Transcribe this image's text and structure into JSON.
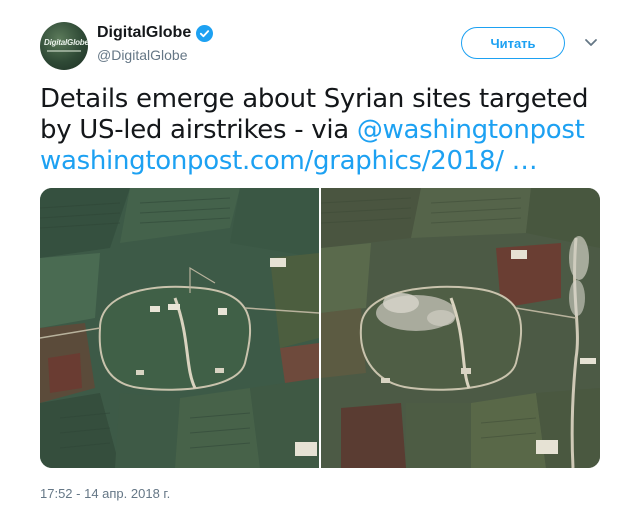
{
  "account": {
    "display_name": "DigitalGlobe",
    "handle": "@DigitalGlobe",
    "avatar_text": "DigitalGlobe",
    "verified": true
  },
  "follow_button": {
    "label": "Читать"
  },
  "menu": {
    "icon": "chevron-down-icon"
  },
  "tweet": {
    "text": "Details emerge about Syrian sites targeted by US-led airstrikes - via ",
    "mention": "@washingtonpost",
    "link": "washingtonpost.com/graphics/2018/  …"
  },
  "media": {
    "images": [
      {
        "name": "satellite-image-before"
      },
      {
        "name": "satellite-image-after"
      }
    ]
  },
  "timestamp": "17:52 - 14 апр. 2018 г.",
  "colors": {
    "accent": "#1da1f2",
    "text": "#14171a",
    "muted": "#657786"
  }
}
